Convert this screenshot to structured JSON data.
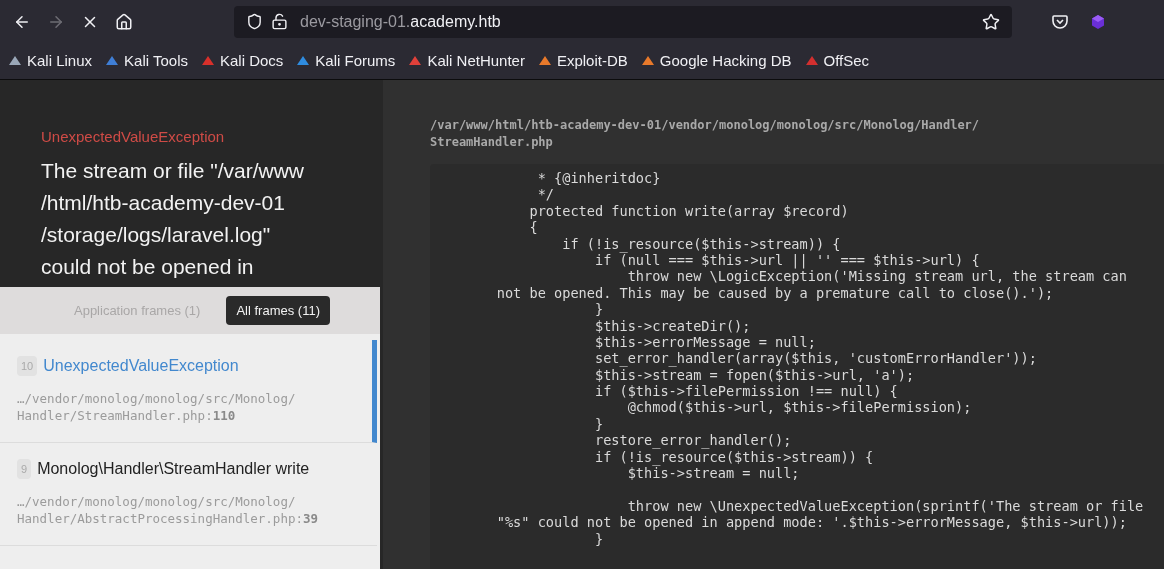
{
  "browser": {
    "nav": [
      {
        "kind": "back",
        "disabled": false
      },
      {
        "kind": "forward",
        "disabled": true
      },
      {
        "kind": "stop",
        "disabled": false
      },
      {
        "kind": "home",
        "disabled": false
      }
    ],
    "url": {
      "host_prefix": "dev-staging-01.",
      "domain": "academy.htb"
    },
    "bookmarks": [
      {
        "label": "Kali Linux",
        "color": "#9aa7b8"
      },
      {
        "label": "Kali Tools",
        "color": "#3f7ed6"
      },
      {
        "label": "Kali Docs",
        "color": "#d8302b"
      },
      {
        "label": "Kali Forums",
        "color": "#2f8ce0"
      },
      {
        "label": "Kali NetHunter",
        "color": "#e0403a"
      },
      {
        "label": "Exploit-DB",
        "color": "#e8792b"
      },
      {
        "label": "Google Hacking DB",
        "color": "#e8792b"
      },
      {
        "label": "OffSec",
        "color": "#d32f2f"
      }
    ]
  },
  "exception": {
    "type": "UnexpectedValueException",
    "message_lines": [
      "The stream or file \"/var/www",
      "/html/htb-academy-dev-01",
      "/storage/logs/laravel.log\"",
      "could not be opened in"
    ]
  },
  "frame_tabs": [
    {
      "label": "Application frames (1)",
      "selected": false
    },
    {
      "label": "All frames (11)",
      "selected": true
    }
  ],
  "frames": [
    {
      "number": "10",
      "name": "UnexpectedValueException",
      "path": "…/vendor/monolog/monolog/src/Monolog/ Handler/StreamHandler.php:",
      "line": "110",
      "selected": true
    },
    {
      "number": "9",
      "name": "Monolog\\Handler\\StreamHandler write",
      "path": "…/vendor/monolog/monolog/src/Monolog/ Handler/AbstractProcessingHandler.php:",
      "line": "39",
      "selected": false
    }
  ],
  "code": {
    "file_path": "/var/www/html/htb-academy-dev-01/vendor/monolog/monolog/src/Monolog/Handler/ StreamHandler.php",
    "lines": [
      "         * {@inheritdoc}",
      "         */",
      "        protected function write(array $record)",
      "        {",
      "            if (!is_resource($this->stream)) {",
      "                if (null === $this->url || '' === $this->url) {",
      "                    throw new \\LogicException('Missing stream url, the stream can",
      "    not be opened. This may be caused by a premature call to close().');",
      "                }",
      "                $this->createDir();",
      "                $this->errorMessage = null;",
      "                set_error_handler(array($this, 'customErrorHandler'));",
      "                $this->stream = fopen($this->url, 'a');",
      "                if ($this->filePermission !== null) {",
      "                    @chmod($this->url, $this->filePermission);",
      "                }",
      "                restore_error_handler();",
      "                if (!is_resource($this->stream)) {",
      "                    $this->stream = null;",
      {
        "text": "                    throw new \\UnexpectedValueException(sprintf('The stream or file",
        "blank_before": true
      },
      "    \"%s\" could not be opened in append mode: '.$this->errorMessage, $this->url));",
      "                }"
    ]
  }
}
